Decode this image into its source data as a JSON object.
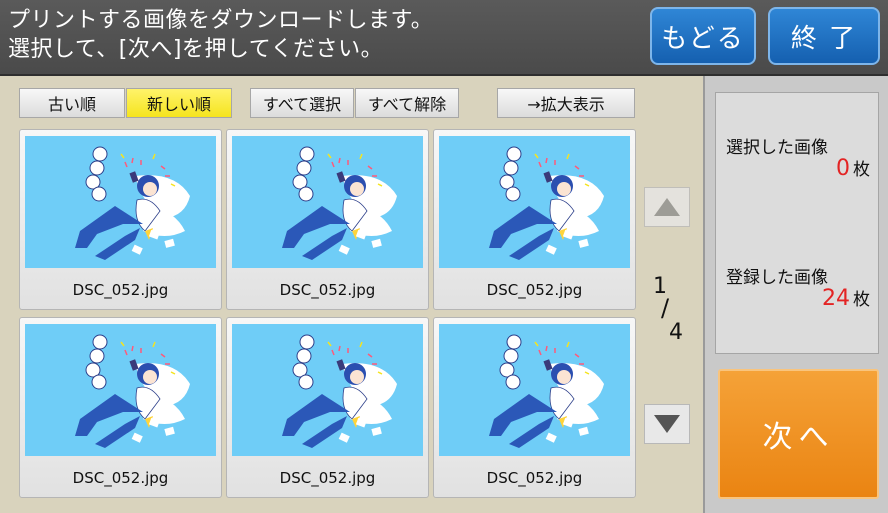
{
  "header": {
    "message_line1": "プリントする画像をダウンロードします。",
    "message_line2": "選択して、[次へ]を押してください。",
    "back_label": "もどる",
    "end_label": "終 了"
  },
  "toolbar": {
    "oldest_label": "古い順",
    "newest_label": "新しい順",
    "select_all_label": "すべて選択",
    "clear_all_label": "すべて解除",
    "zoom_label": "→拡大表示"
  },
  "thumbnails": [
    {
      "filename": "DSC_052.jpg"
    },
    {
      "filename": "DSC_052.jpg"
    },
    {
      "filename": "DSC_052.jpg"
    },
    {
      "filename": "DSC_052.jpg"
    },
    {
      "filename": "DSC_052.jpg"
    },
    {
      "filename": "DSC_052.jpg"
    }
  ],
  "pager": {
    "current": "1",
    "separator": "/",
    "total": "4"
  },
  "side": {
    "selected_label": "選択した画像",
    "selected_count": "0",
    "registered_label": "登録した画像",
    "registered_count": "24",
    "count_unit": "枚",
    "next_label": "次へ"
  },
  "colors": {
    "header_bg": "#4f4f4f",
    "blue_button": "#1f6fc0",
    "active_sort": "#f5e41e",
    "thumb_sky": "#6fcdf7",
    "count_red": "#e32424",
    "next_orange": "#ea8412"
  },
  "icons": [
    "arrow-up-icon",
    "arrow-down-icon"
  ]
}
